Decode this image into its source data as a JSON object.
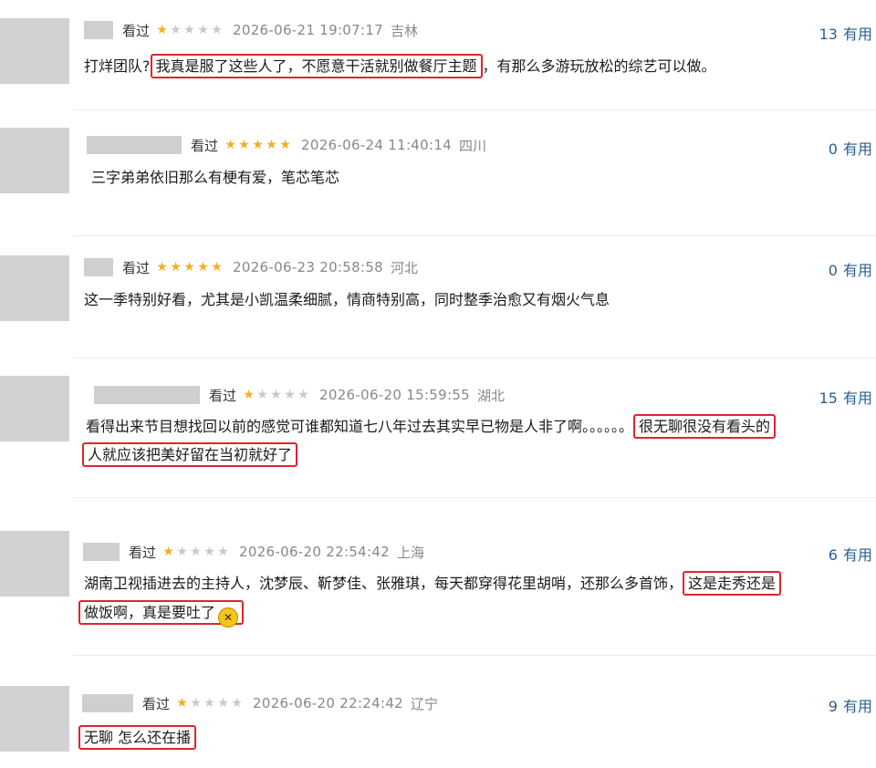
{
  "reviews": [
    {
      "status": "看过",
      "rating": 1,
      "date": "2026-06-21 19:07:17",
      "location": "吉林",
      "useful_count": "13",
      "useful_label": "有用",
      "content_pre": "打烊团队?",
      "highlight": "我真是服了这些人了，不愿意干活就别做餐厅主题",
      "content_post": "，有那么多游玩放松的综艺可以做。"
    },
    {
      "status": "看过",
      "rating": 5,
      "date": "2026-06-24 11:40:14",
      "location": "四川",
      "useful_count": "0",
      "useful_label": "有用",
      "content": "三字弟弟依旧那么有梗有爱，笔芯笔芯"
    },
    {
      "status": "看过",
      "rating": 5,
      "date": "2026-06-23 20:58:58",
      "location": "河北",
      "useful_count": "0",
      "useful_label": "有用",
      "content": "这一季特别好看，尤其是小凯温柔细腻，情商特别高，同时整季治愈又有烟火气息"
    },
    {
      "status": "看过",
      "rating": 1,
      "date": "2026-06-20 15:59:55",
      "location": "湖北",
      "useful_count": "15",
      "useful_label": "有用",
      "content_pre": "看得出来节目想找回以前的感觉可谁都知道七八年过去其实早已物是人非了啊。。。。。。",
      "highlight_a": "很无聊很没有看头的",
      "highlight_b": "人就应该把美好留在当初就好了"
    },
    {
      "status": "看过",
      "rating": 1,
      "date": "2026-06-20 22:54:42",
      "location": "上海",
      "useful_count": "6",
      "useful_label": "有用",
      "content_pre": "湖南卫视插进去的主持人，沈梦辰、靳梦佳、张雅琪，每天都穿得花里胡哨，还那么多首饰，",
      "highlight_a": "这是走秀还是",
      "highlight_b": "做饭啊，真是要吐了"
    },
    {
      "status": "看过",
      "rating": 1,
      "date": "2026-06-20 22:24:42",
      "location": "辽宁",
      "useful_count": "9",
      "useful_label": "有用",
      "highlight": "无聊 怎么还在播"
    }
  ],
  "star_icon": "star-icon",
  "emoji_icon": "vomit-emoji-icon",
  "colors": {
    "star_on": "#f2b01e",
    "star_off": "#c9c9c9",
    "highlight_box": "#e0242c",
    "useful": "#2a5f8f"
  }
}
